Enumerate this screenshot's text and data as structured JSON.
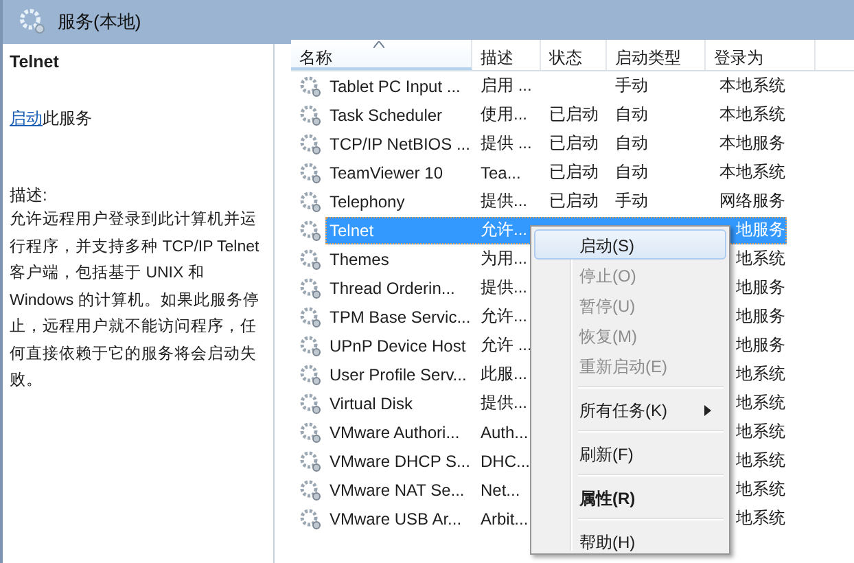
{
  "header": {
    "title": "服务(本地)"
  },
  "detail": {
    "service_name": "Telnet",
    "action_link": "启动",
    "action_text": "此服务",
    "description_label": "描述:",
    "description": "允许远程用户登录到此计算机并运行程序，并支持多种 TCP/IP Telnet 客户端，包括基于 UNIX 和 Windows 的计算机。如果此服务停止，远程用户就不能访问程序，任何直接依赖于它的服务将会启动失败。"
  },
  "table": {
    "columns": [
      {
        "label": "名称",
        "sorted": true
      },
      {
        "label": "描述",
        "sorted": false
      },
      {
        "label": "状态",
        "sorted": false
      },
      {
        "label": "启动类型",
        "sorted": false
      },
      {
        "label": "登录为",
        "sorted": false
      }
    ],
    "rows": [
      {
        "name": "Tablet PC Input ...",
        "desc": "启用 ...",
        "status": "",
        "type": "手动",
        "logon": "本地系统",
        "selected": false
      },
      {
        "name": "Task Scheduler",
        "desc": "使用...",
        "status": "已启动",
        "type": "自动",
        "logon": "本地系统",
        "selected": false
      },
      {
        "name": "TCP/IP NetBIOS ...",
        "desc": "提供 ...",
        "status": "已启动",
        "type": "自动",
        "logon": "本地服务",
        "selected": false
      },
      {
        "name": "TeamViewer 10",
        "desc": "Tea...",
        "status": "已启动",
        "type": "自动",
        "logon": "本地系统",
        "selected": false
      },
      {
        "name": "Telephony",
        "desc": "提供...",
        "status": "已启动",
        "type": "手动",
        "logon": "网络服务",
        "selected": false
      },
      {
        "name": "Telnet",
        "desc": "允许...",
        "logon": "地服务",
        "selected": true
      },
      {
        "name": "Themes",
        "desc": "为用...",
        "logon": "地系统",
        "selected": false
      },
      {
        "name": "Thread Orderin...",
        "desc": "提供...",
        "logon": "地服务",
        "selected": false
      },
      {
        "name": "TPM Base Servic...",
        "desc": "允许...",
        "logon": "地服务",
        "selected": false
      },
      {
        "name": "UPnP Device Host",
        "desc": "允许 ...",
        "logon": "地服务",
        "selected": false
      },
      {
        "name": "User Profile Serv...",
        "desc": "此服...",
        "logon": "地系统",
        "selected": false
      },
      {
        "name": "Virtual Disk",
        "desc": "提供...",
        "logon": "地系统",
        "selected": false
      },
      {
        "name": "VMware Authori...",
        "desc": "Auth...",
        "logon": "地系统",
        "selected": false
      },
      {
        "name": "VMware DHCP S...",
        "desc": "DHC...",
        "logon": "地系统",
        "selected": false
      },
      {
        "name": "VMware NAT Se...",
        "desc": "Net...",
        "logon": "地系统",
        "selected": false
      },
      {
        "name": "VMware USB Ar...",
        "desc": "Arbit...",
        "logon": "地系统",
        "selected": false
      }
    ]
  },
  "context_menu": {
    "items": [
      {
        "kind": "item",
        "label": "启动(S)",
        "selected": true,
        "disabled": false,
        "bold": false,
        "submenu": false
      },
      {
        "kind": "item",
        "label": "停止(O)",
        "selected": false,
        "disabled": true,
        "bold": false,
        "submenu": false
      },
      {
        "kind": "item",
        "label": "暂停(U)",
        "selected": false,
        "disabled": true,
        "bold": false,
        "submenu": false
      },
      {
        "kind": "item",
        "label": "恢复(M)",
        "selected": false,
        "disabled": true,
        "bold": false,
        "submenu": false
      },
      {
        "kind": "item",
        "label": "重新启动(E)",
        "selected": false,
        "disabled": true,
        "bold": false,
        "submenu": false
      },
      {
        "kind": "separator"
      },
      {
        "kind": "item",
        "label": "所有任务(K)",
        "selected": false,
        "disabled": false,
        "bold": false,
        "submenu": true
      },
      {
        "kind": "separator"
      },
      {
        "kind": "item",
        "label": "刷新(F)",
        "selected": false,
        "disabled": false,
        "bold": false,
        "submenu": false
      },
      {
        "kind": "separator"
      },
      {
        "kind": "item",
        "label": "属性(R)",
        "selected": false,
        "disabled": false,
        "bold": true,
        "submenu": false
      },
      {
        "kind": "separator"
      },
      {
        "kind": "item",
        "label": "帮助(H)",
        "selected": false,
        "disabled": false,
        "bold": false,
        "submenu": false
      }
    ]
  }
}
